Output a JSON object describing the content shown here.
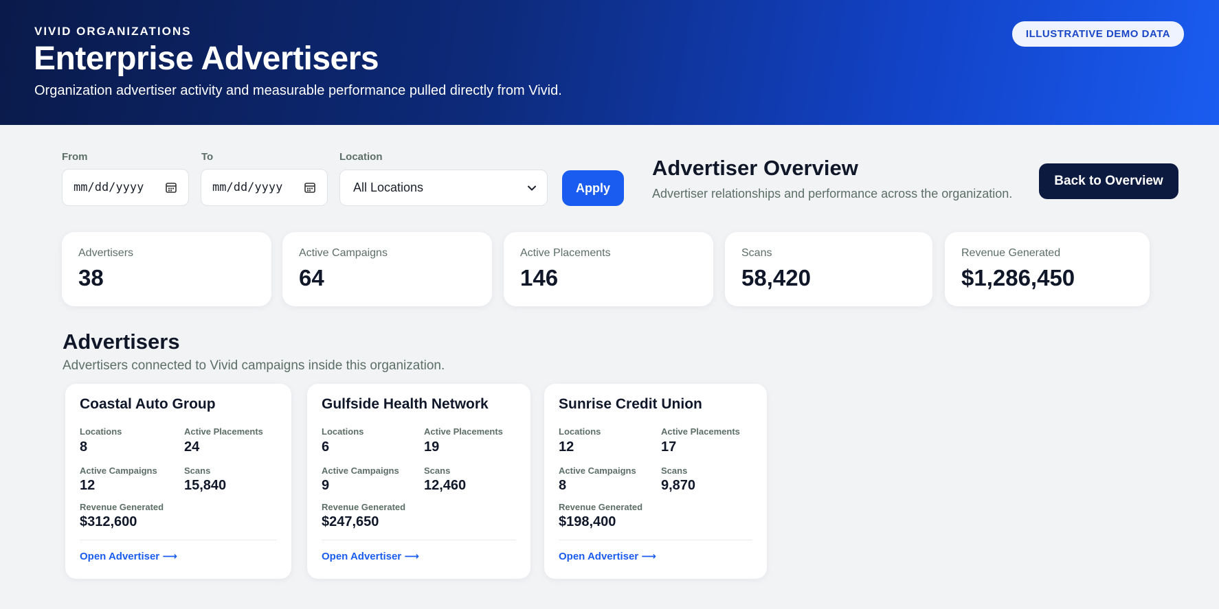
{
  "header": {
    "eyebrow": "VIVID ORGANIZATIONS",
    "title": "Enterprise Advertisers",
    "subtitle": "Organization advertiser activity and measurable performance pulled directly from Vivid.",
    "badge": "ILLUSTRATIVE DEMO DATA"
  },
  "filters": {
    "from_label": "From",
    "from_value": "mm/dd/yyyy",
    "to_label": "To",
    "to_value": "mm/dd/yyyy",
    "location_label": "Location",
    "location_value": "All Locations",
    "apply_label": "Apply",
    "calendar_icon": "calendar-icon",
    "chevron_icon": "chevron-down-icon"
  },
  "overview": {
    "title": "Advertiser Overview",
    "subtitle": "Advertiser relationships and performance across the organization.",
    "back_label": "Back to Overview"
  },
  "kpis": [
    {
      "label": "Advertisers",
      "value": "38"
    },
    {
      "label": "Active Campaigns",
      "value": "64"
    },
    {
      "label": "Active Placements",
      "value": "146"
    },
    {
      "label": "Scans",
      "value": "58,420"
    },
    {
      "label": "Revenue Generated",
      "value": "$1,286,450"
    }
  ],
  "advertisers_section": {
    "title": "Advertisers",
    "subtitle": "Advertisers connected to Vivid campaigns inside this organization.",
    "metric_labels": {
      "locations": "Locations",
      "active_placements": "Active Placements",
      "active_campaigns": "Active Campaigns",
      "scans": "Scans",
      "revenue": "Revenue Generated"
    },
    "link_label": "Open Advertiser ⟶",
    "cards": [
      {
        "name": "Coastal Auto Group",
        "locations": "8",
        "active_placements": "24",
        "active_campaigns": "12",
        "scans": "15,840",
        "revenue": "$312,600"
      },
      {
        "name": "Gulfside Health Network",
        "locations": "6",
        "active_placements": "19",
        "active_campaigns": "9",
        "scans": "12,460",
        "revenue": "$247,650"
      },
      {
        "name": "Sunrise Credit Union",
        "locations": "12",
        "active_placements": "17",
        "active_campaigns": "8",
        "scans": "9,870",
        "revenue": "$198,400"
      }
    ]
  },
  "colors": {
    "accent": "#1a5cf0",
    "dark_button": "#0c1a3f",
    "muted_text": "#5c6e66"
  }
}
